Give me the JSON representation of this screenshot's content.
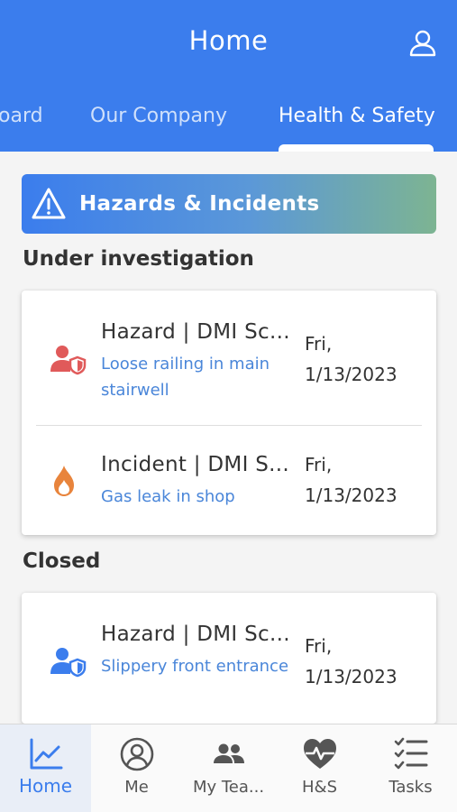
{
  "header": {
    "title": "Home",
    "profile_icon": "user-icon",
    "bg_color": "#3b7ded"
  },
  "tabs": [
    {
      "label": "oard",
      "active": false
    },
    {
      "label": "Our Company",
      "active": false
    },
    {
      "label": "Health & Safety",
      "active": true
    }
  ],
  "banner": {
    "icon": "warning-icon",
    "label": "Hazards & Incidents"
  },
  "sections": {
    "under_investigation": {
      "title": "Under investigation",
      "items": [
        {
          "icon": "hazard-user-shield-icon",
          "icon_color": "#e05a5a",
          "title": "Hazard | DMI Sc...",
          "description": "Loose railing in main stairwell",
          "date_day": "Fri,",
          "date": "1/13/2023"
        },
        {
          "icon": "flame-icon",
          "icon_color": "#e8843c",
          "title": "Incident | DMI S...",
          "description": "Gas leak in shop",
          "date_day": "Fri,",
          "date": "1/13/2023"
        }
      ]
    },
    "closed": {
      "title": "Closed",
      "items": [
        {
          "icon": "hazard-user-shield-icon",
          "icon_color": "#3b7ded",
          "title": "Hazard | DMI Sc...",
          "description": "Slippery front entrance",
          "date_day": "Fri,",
          "date": "1/13/2023"
        }
      ]
    }
  },
  "bottom_nav": [
    {
      "label": "Home",
      "icon": "chart-line-icon",
      "active": true
    },
    {
      "label": "Me",
      "icon": "user-circle-icon",
      "active": false
    },
    {
      "label": "My Tea...",
      "icon": "team-icon",
      "active": false
    },
    {
      "label": "H&S",
      "icon": "heart-pulse-icon",
      "active": false
    },
    {
      "label": "Tasks",
      "icon": "tasks-list-icon",
      "active": false
    }
  ],
  "colors": {
    "accent": "#3b7ded",
    "link_text": "#4a86d9"
  }
}
